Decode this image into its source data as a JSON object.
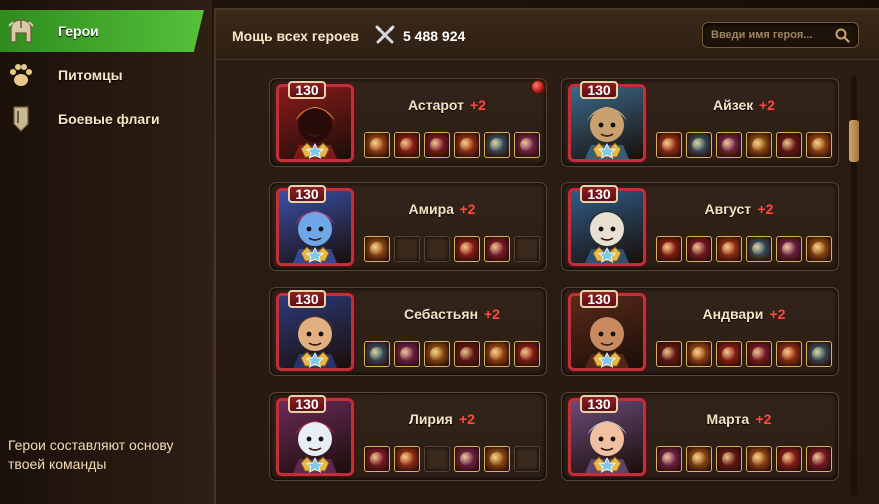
{
  "sidebar": {
    "items": [
      {
        "label": "Герои",
        "icon": "helmet-icon",
        "active": true
      },
      {
        "label": "Питомцы",
        "icon": "paw-icon",
        "active": false
      },
      {
        "label": "Боевые флаги",
        "icon": "banner-icon",
        "active": false
      }
    ],
    "tip": "Герои составляют основу твоей команды"
  },
  "header": {
    "power_label": "Мощь всех героев",
    "power_icon": "crossed-swords-icon",
    "power_value": "5 488 924",
    "search_placeholder": "Введи имя героя...",
    "search_icon": "magnifier-icon"
  },
  "colors": {
    "active_tab": "#3fa52a",
    "bonus": "#ff4a3c",
    "level_badge": "#8e1f24",
    "scroll_thumb": "#c08a4e"
  },
  "heroes": [
    {
      "name": "Астарот",
      "level": "130",
      "bonus": "+2",
      "notification": true,
      "slots": [
        "full",
        "full",
        "full",
        "full",
        "full",
        "full"
      ]
    },
    {
      "name": "Айзек",
      "level": "130",
      "bonus": "+2",
      "notification": false,
      "slots": [
        "full",
        "full",
        "full",
        "full",
        "full",
        "full"
      ]
    },
    {
      "name": "Амира",
      "level": "130",
      "bonus": "+2",
      "notification": false,
      "slots": [
        "full",
        "empty",
        "empty",
        "full",
        "full",
        "empty"
      ]
    },
    {
      "name": "Август",
      "level": "130",
      "bonus": "+2",
      "notification": false,
      "slots": [
        "full",
        "full",
        "full",
        "full",
        "full",
        "full"
      ]
    },
    {
      "name": "Себастьян",
      "level": "130",
      "bonus": "+2",
      "notification": false,
      "slots": [
        "full",
        "full",
        "full",
        "full",
        "full",
        "full"
      ]
    },
    {
      "name": "Андвари",
      "level": "130",
      "bonus": "+2",
      "notification": false,
      "slots": [
        "full",
        "full",
        "full",
        "full",
        "full",
        "full"
      ]
    },
    {
      "name": "Лирия",
      "level": "130",
      "bonus": "+2",
      "notification": false,
      "slots": [
        "full",
        "full",
        "empty",
        "full",
        "full",
        "empty"
      ]
    },
    {
      "name": "Марта",
      "level": "130",
      "bonus": "+2",
      "notification": false,
      "slots": [
        "full",
        "full",
        "full",
        "full",
        "full",
        "full"
      ]
    }
  ]
}
